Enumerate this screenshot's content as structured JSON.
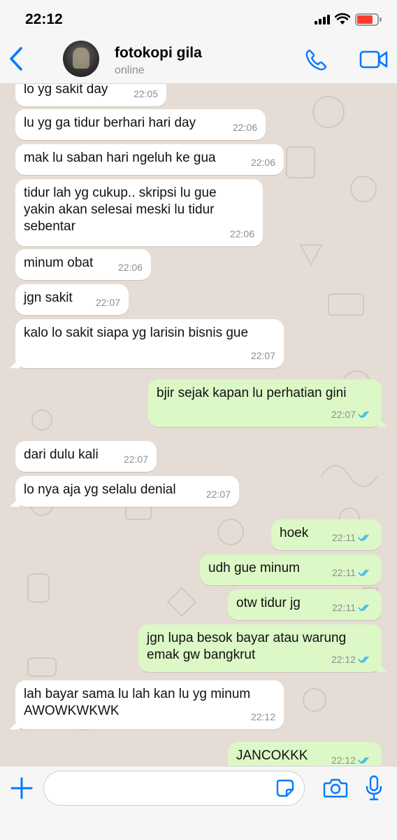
{
  "status_bar": {
    "time": "22:12"
  },
  "header": {
    "contact_name": "fotokopi gila",
    "contact_status": "online"
  },
  "colors": {
    "accent": "#007aff",
    "incoming_bubble": "#ffffff",
    "outgoing_bubble": "#dcf8c6",
    "read_ticks": "#34b7f1",
    "chat_background": "#e5ddd5"
  },
  "messages": [
    {
      "dir": "in",
      "text": "lo yg sakit day",
      "time": "22:05"
    },
    {
      "dir": "in",
      "text": "lu yg ga tidur berhari hari day",
      "time": "22:06"
    },
    {
      "dir": "in",
      "text": "mak lu saban hari ngeluh ke gua",
      "time": "22:06"
    },
    {
      "dir": "in",
      "text": "tidur lah yg cukup.. skripsi lu gue\nyakin akan selesai meski lu tidur\nsebentar",
      "time": "22:06"
    },
    {
      "dir": "in",
      "text": "minum obat",
      "time": "22:06"
    },
    {
      "dir": "in",
      "text": "jgn sakit",
      "time": "22:07"
    },
    {
      "dir": "in",
      "text": "kalo lo sakit siapa yg larisin bisnis gue",
      "time": "22:07"
    },
    {
      "dir": "out",
      "text": "bjir sejak kapan lu perhatian gini",
      "time": "22:07"
    },
    {
      "dir": "in",
      "text": "dari dulu kali",
      "time": "22:07"
    },
    {
      "dir": "in",
      "text": "lo nya aja yg selalu denial",
      "time": "22:07"
    },
    {
      "dir": "out",
      "text": "hoek",
      "time": "22:11"
    },
    {
      "dir": "out",
      "text": "udh gue minum",
      "time": "22:11"
    },
    {
      "dir": "out",
      "text": "otw tidur jg",
      "time": "22:11"
    },
    {
      "dir": "out",
      "text": "jgn lupa besok bayar atau warung\nemak gw bangkrut",
      "time": "22:12"
    },
    {
      "dir": "in",
      "text": "lah bayar sama lu lah kan lu yg minum\nAWOWKWKWK",
      "time": "22:12"
    },
    {
      "dir": "out",
      "text": "JANCOKKK",
      "time": "22:12"
    }
  ],
  "composer": {
    "value": "",
    "placeholder": ""
  },
  "icons": [
    "back-chevron-icon",
    "phone-icon",
    "video-camera-icon",
    "plus-icon",
    "sticker-icon",
    "camera-icon",
    "microphone-icon",
    "double-check-icon"
  ]
}
